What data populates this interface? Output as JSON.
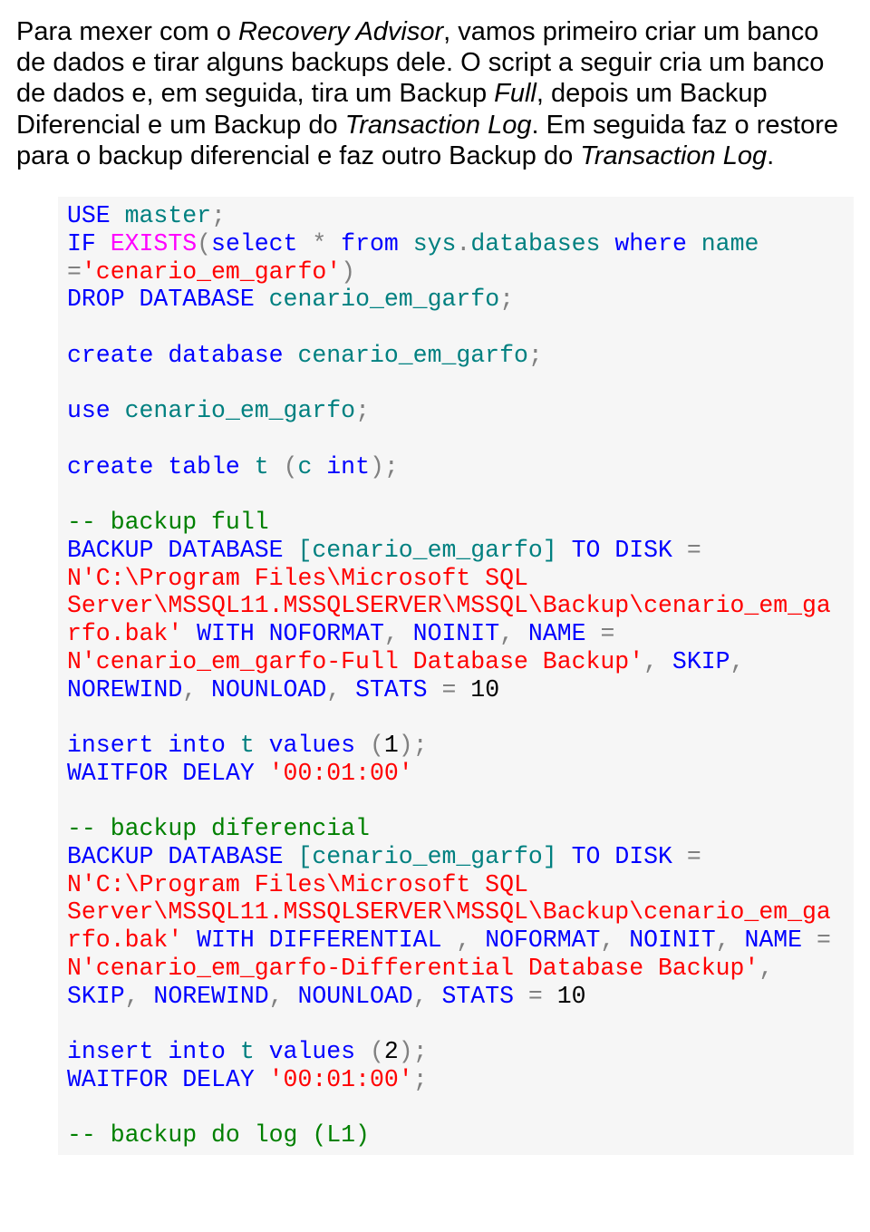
{
  "para": {
    "s1a": "Para mexer com o ",
    "s1b": "Recovery Advisor",
    "s1c": ", vamos primeiro criar um banco de dados e tirar alguns backups dele. O script a seguir cria um banco de dados e, em seguida, tira um Backup ",
    "s1d": "Full",
    "s1e": ", depois um Backup Diferencial e um Backup do ",
    "s1f": "Transaction Log",
    "s1g": ". Em seguida faz o restore para o backup diferencial e faz outro Backup do ",
    "s1h": "Transaction Log",
    "s1i": "."
  },
  "code": {
    "l1_use": "USE",
    "l1_master": " master",
    "semi": ";",
    "l2_if": "IF",
    "l2_exists": " EXISTS",
    "lparen": "(",
    "rparen": ")",
    "l2_select": "select",
    "l2_star": " *",
    "l2_from": " from",
    "l2_sys": " sys",
    "dot": ".",
    "l2_db": "databases",
    "l2_where": " where",
    "l2_name": " name ",
    "eq": "=",
    "l3_str": "'cenario_em_garfo'",
    "l4_drop": "DROP",
    "l4_database": " DATABASE",
    "l4_name": " cenario_em_garfo",
    "l6_create": "create",
    "l6_database": " database",
    "l6_name": " cenario_em_garfo",
    "l8_use": "use",
    "l8_name": " cenario_em_garfo",
    "l10_create": "create",
    "l10_table": " table",
    "l10_t": " t ",
    "l10_c": "c ",
    "l10_int": "int",
    "cmt_full": "-- backup full",
    "bk_backup": "BACKUP",
    "bk_database": " DATABASE",
    "bk_name": " [cenario_em_garfo] ",
    "bk_to": "TO",
    "bk_disk": " DISK",
    "sp": " ",
    "bk_path1": "N'C:\\Program Files\\Microsoft SQL Server\\MSSQL11.MSSQLSERVER\\MSSQL\\Backup\\cenario_em_garfo.bak'",
    "bk_with": " WITH",
    "bk_noformat": " NOFORMAT",
    "comma": ",",
    "bk_noinit": " NOINIT",
    "bk_namekw": " NAME",
    "bkfull_namestr": " N'cenario_em_garfo-Full Database Backup'",
    "bk_skip": " SKIP",
    "bk_norewind": " NOREWIND",
    "bk_nounload": " NOUNLOAD",
    "bk_stats": " STATS",
    "bk_ten": " 10",
    "ins_insert": "insert",
    "ins_into": " into",
    "ins_t": " t ",
    "ins_values": "values",
    "ins_1": "1",
    "ins_2": "2",
    "wait_kw": "WAITFOR",
    "delay_kw": " DELAY",
    "delay_str": " '00:01:00'",
    "cmt_diff": "-- backup diferencial",
    "bk_differential": " DIFFERENTIAL ",
    "bkdiff_namestr": " N'cenario_em_garfo-Differential Database Backup'",
    "cmt_log": "-- backup do log (L1)"
  }
}
